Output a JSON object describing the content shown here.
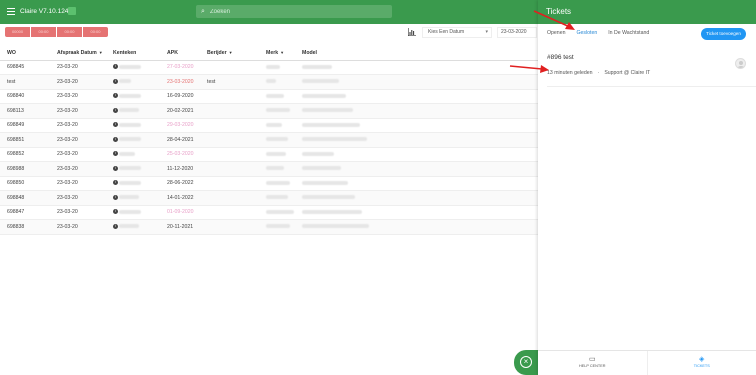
{
  "app": {
    "title": "Claire V7.10.124"
  },
  "search": {
    "placeholder": "Zoeken"
  },
  "filters": {
    "pills": [
      "00000",
      "00:00",
      "00:00",
      "00:00"
    ],
    "date_select": "Kies Een Datum",
    "date_value": "23-03-2020"
  },
  "table": {
    "columns": [
      "WO",
      "Afspraak Datum",
      "Kenteken",
      "APK",
      "Berijder",
      "Merk",
      "Model"
    ],
    "rows": [
      {
        "wo": "698845",
        "date": "23-03-20",
        "apk": "27-03-2020",
        "apk_state": "pink",
        "driver": ""
      },
      {
        "wo": "test",
        "date": "23-03-20",
        "apk": "23-03-2020",
        "apk_state": "red",
        "driver": "test"
      },
      {
        "wo": "698840",
        "date": "23-03-20",
        "apk": "16-09-2020",
        "apk_state": "normal",
        "driver": ""
      },
      {
        "wo": "698113",
        "date": "23-03-20",
        "apk": "20-02-2021",
        "apk_state": "normal",
        "driver": ""
      },
      {
        "wo": "698849",
        "date": "23-03-20",
        "apk": "29-03-2020",
        "apk_state": "pink",
        "driver": ""
      },
      {
        "wo": "698851",
        "date": "23-03-20",
        "apk": "28-04-2021",
        "apk_state": "normal",
        "driver": ""
      },
      {
        "wo": "698852",
        "date": "23-03-20",
        "apk": "25-03-2020",
        "apk_state": "pink",
        "driver": ""
      },
      {
        "wo": "698988",
        "date": "23-03-20",
        "apk": "11-12-2020",
        "apk_state": "normal",
        "driver": ""
      },
      {
        "wo": "698850",
        "date": "23-03-20",
        "apk": "28-06-2022",
        "apk_state": "normal",
        "driver": ""
      },
      {
        "wo": "698848",
        "date": "23-03-20",
        "apk": "14-01-2022",
        "apk_state": "normal",
        "driver": ""
      },
      {
        "wo": "698847",
        "date": "23-03-20",
        "apk": "01-09-2020",
        "apk_state": "pink",
        "driver": ""
      },
      {
        "wo": "698838",
        "date": "23-03-20",
        "apk": "20-11-2021",
        "apk_state": "normal",
        "driver": ""
      }
    ]
  },
  "panel": {
    "title": "Tickets",
    "tabs": [
      "Openen",
      "Gesloten",
      "In De Wachtstand"
    ],
    "active_tab": "Gesloten",
    "new_ticket_label": "Ticket toevoegen",
    "ticket": {
      "title": "#896 test",
      "time": "13 minuten geleden",
      "sep": "·",
      "team": "Support @ Claire IT"
    },
    "bottom_tabs": {
      "help": "HELP CENTER",
      "tickets": "TICKETS"
    }
  },
  "colors": {
    "brand_green": "#3a9a4d",
    "accent_blue": "#2196f3",
    "overdue_red": "#e57373",
    "arrow_red": "#e02020"
  }
}
